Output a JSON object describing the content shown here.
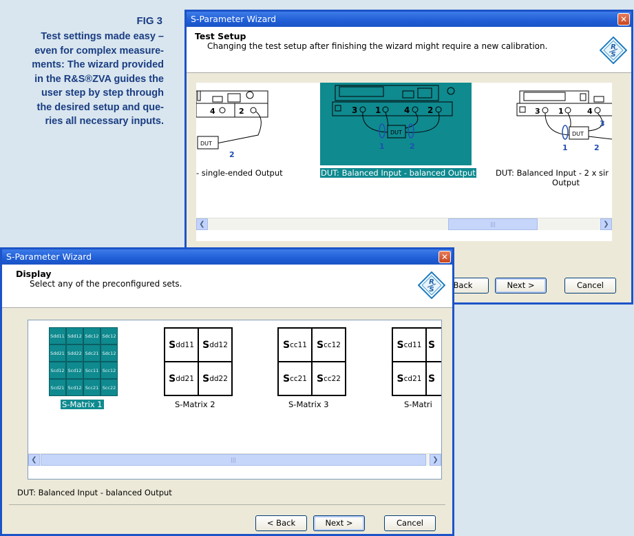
{
  "caption": {
    "fig": "FIG 3",
    "lines": [
      "Test settings made easy –",
      "even for complex measure-",
      "ments: The wizard provided",
      "in the R&S®ZVA guides the",
      "user step by step through",
      "the desired setup and que-",
      "ries all necessary inputs."
    ]
  },
  "back_window": {
    "title": "S-Parameter Wizard",
    "close": "✕",
    "header_title": "Test Setup",
    "header_sub": "Changing the test setup after finishing the wizard might require a new calibration.",
    "setups": [
      {
        "label": "- single-ended Output",
        "ports": [
          "4",
          "2"
        ]
      },
      {
        "label": "DUT: Balanced Input - balanced Output",
        "ports": [
          "3",
          "1",
          "4",
          "2"
        ]
      },
      {
        "label_line1": "DUT: Balanced Input - 2 x sir",
        "label_line2": "Output",
        "ports": [
          "3",
          "1",
          "4"
        ]
      }
    ],
    "dut": "DUT",
    "buttons": {
      "back": "Back",
      "next": "Next >",
      "cancel": "Cancel"
    }
  },
  "front_window": {
    "title": "S-Parameter Wizard",
    "close": "✕",
    "header_title": "Display",
    "header_sub": "Select any of the preconfigured sets.",
    "matrix1_cells": [
      "Sdd11",
      "Sdd12",
      "Sdc12",
      "Sdc12",
      "Sdd21",
      "Sdd22",
      "Sdc21",
      "Sdc12",
      "Scd12",
      "Scd12",
      "Scc11",
      "Scc12",
      "Scd21",
      "Scd12",
      "Scc21",
      "Scc22"
    ],
    "matrices": [
      {
        "label": "S-Matrix 1"
      },
      {
        "label": "S-Matrix 2",
        "cells": [
          {
            "big": "S",
            "sub": "dd11"
          },
          {
            "big": "S",
            "sub": "dd12"
          },
          {
            "big": "S",
            "sub": "dd21"
          },
          {
            "big": "S",
            "sub": "dd22"
          }
        ]
      },
      {
        "label": "S-Matrix 3",
        "cells": [
          {
            "big": "S",
            "sub": "cc11"
          },
          {
            "big": "S",
            "sub": "cc12"
          },
          {
            "big": "S",
            "sub": "cc21"
          },
          {
            "big": "S",
            "sub": "cc22"
          }
        ]
      },
      {
        "label": "S-Matri",
        "cells": [
          {
            "big": "S",
            "sub": "cd11"
          },
          {
            "big": "S",
            "sub": ""
          },
          {
            "big": "S",
            "sub": "cd21"
          },
          {
            "big": "S",
            "sub": ""
          }
        ]
      }
    ],
    "status": "DUT: Balanced Input - balanced Output",
    "buttons": {
      "back": "< Back",
      "next": "Next >",
      "cancel": "Cancel"
    }
  },
  "colors": {
    "selection": "#0f8a8f",
    "titlebar": "#1f5ed6",
    "caption": "#1a3d82"
  },
  "icons": [
    "rs-logo-icon",
    "close-icon",
    "scroll-left-icon",
    "scroll-right-icon"
  ]
}
